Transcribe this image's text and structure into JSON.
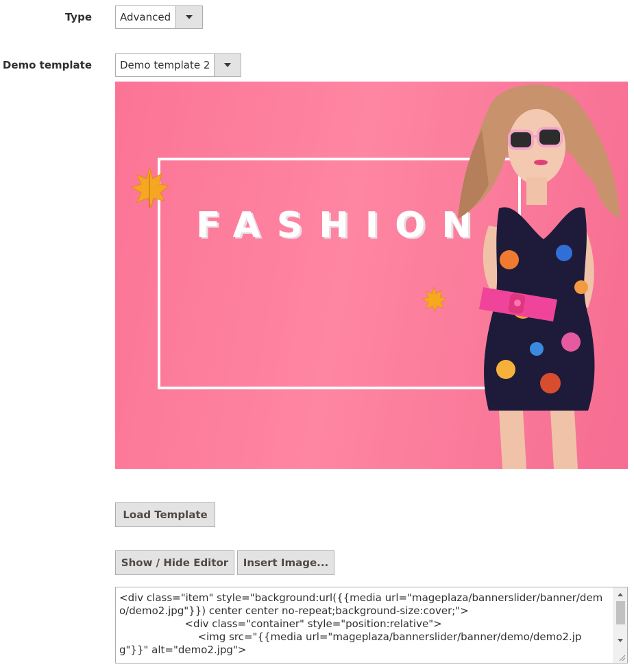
{
  "form": {
    "type": {
      "label": "Type",
      "value": "Advanced"
    },
    "demo_template": {
      "label": "Demo template",
      "value": "Demo template 2"
    }
  },
  "banner": {
    "headline": "FASHION",
    "colors": {
      "background": "#fb7a9a",
      "frame": "#ffffff",
      "bag": "#f0449a",
      "sunglasses": "#f4a6c8"
    }
  },
  "buttons": {
    "load_template": "Load Template",
    "show_hide_editor": "Show / Hide Editor",
    "insert_image": "Insert Image..."
  },
  "editor": {
    "content": "<div class=\"item\" style=\"background:url({{media url=\"mageplaza/bannerslider/banner/demo/demo2.jpg\"}}) center center no-repeat;background-size:cover;\">\n                    <div class=\"container\" style=\"position:relative\">\n                        <img src=\"{{media url=\"mageplaza/bannerslider/banner/demo/demo2.jpg\"}}\" alt=\"demo2.jpg\">"
  },
  "icons": {
    "dropdown": "chevron-down-icon",
    "scroll_up": "scroll-up-icon",
    "scroll_down": "scroll-down-icon",
    "resize": "resize-grip-icon"
  }
}
